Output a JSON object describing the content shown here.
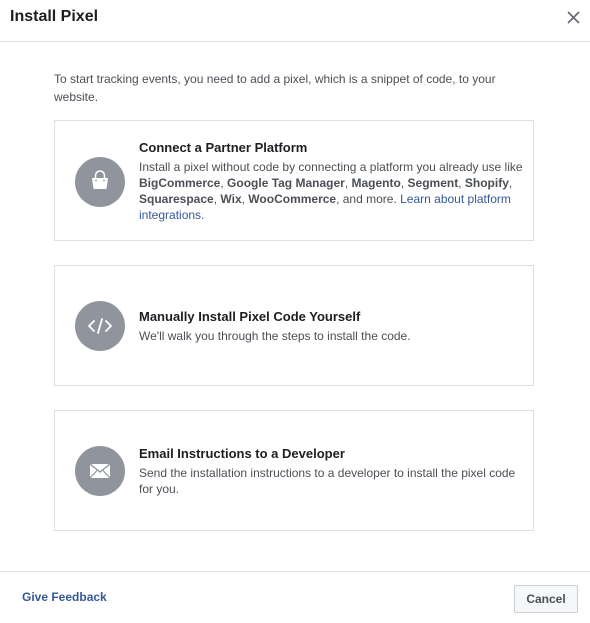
{
  "dialog": {
    "title": "Install Pixel",
    "close_icon": "close-icon"
  },
  "intro": "To start tracking events, you need to add a pixel, which is a snippet of code, to your website.",
  "options": [
    {
      "icon": "shopping-bag-icon",
      "title": "Connect a Partner Platform",
      "desc_lead": "Install a pixel without code by connecting a platform you already use like ",
      "platforms": [
        "BigCommerce",
        "Google Tag Manager",
        "Magento",
        "Segment",
        "Shopify",
        "Squarespace",
        "Wix",
        "WooCommerce"
      ],
      "separator": ", ",
      "desc_tail": ", and more. ",
      "link": "Learn about platform integrations",
      "link_end": "."
    },
    {
      "icon": "code-icon",
      "title": "Manually Install Pixel Code Yourself",
      "desc": "We'll walk you through the steps to install the code."
    },
    {
      "icon": "envelope-icon",
      "title": "Email Instructions to a Developer",
      "desc": "Send the installation instructions to a developer to install the pixel code for you."
    }
  ],
  "footer": {
    "feedback_label": "Give Feedback",
    "cancel_label": "Cancel"
  },
  "colors": {
    "link": "#365899",
    "icon_circle": "#90949c",
    "border": "#dddfe2"
  }
}
